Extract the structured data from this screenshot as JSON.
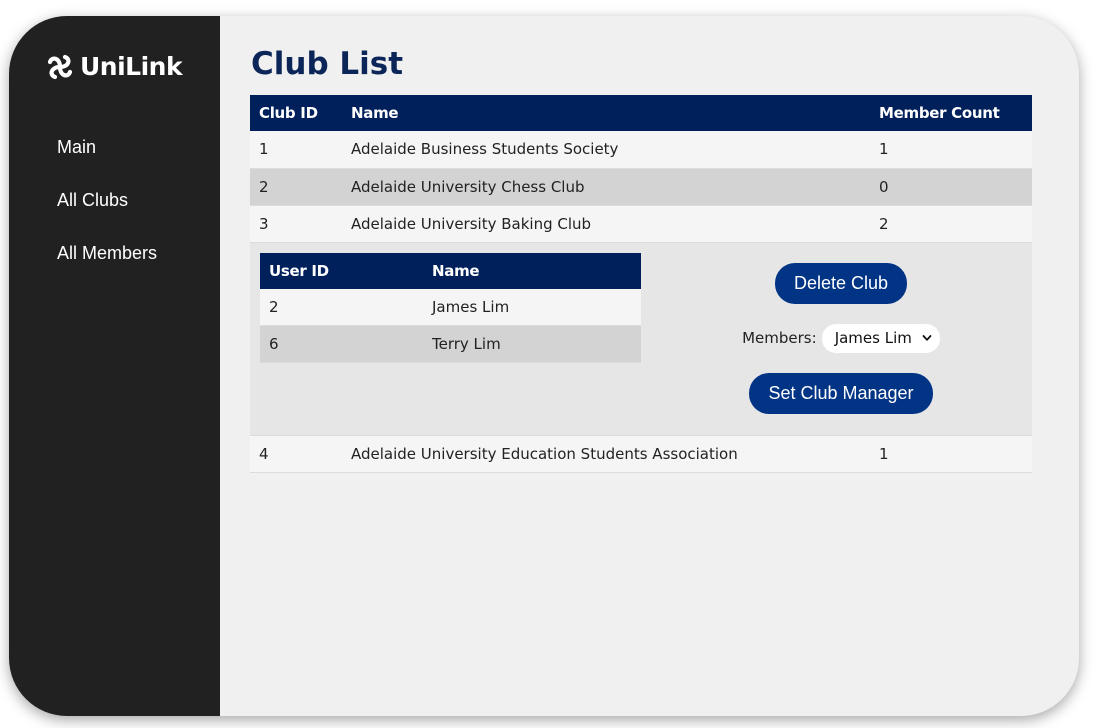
{
  "brand": {
    "name": "UniLink"
  },
  "sidebar": {
    "items": [
      {
        "label": "Main"
      },
      {
        "label": "All Clubs"
      },
      {
        "label": "All Members"
      }
    ]
  },
  "page": {
    "title": "Club List"
  },
  "clubs_table": {
    "headers": {
      "id": "Club ID",
      "name": "Name",
      "count": "Member Count"
    },
    "rows": [
      {
        "id": "1",
        "name": "Adelaide Business Students Society",
        "count": "1"
      },
      {
        "id": "2",
        "name": "Adelaide University Chess Club",
        "count": "0"
      },
      {
        "id": "3",
        "name": "Adelaide University Baking Club",
        "count": "2"
      },
      {
        "id": "4",
        "name": "Adelaide University Education Students Association",
        "count": "1"
      }
    ]
  },
  "club_detail": {
    "headers": {
      "user_id": "User ID",
      "name": "Name"
    },
    "members": [
      {
        "user_id": "2",
        "name": "James Lim"
      },
      {
        "user_id": "6",
        "name": "Terry Lim"
      }
    ],
    "delete_label": "Delete Club",
    "members_label": "Members:",
    "selected_member": "James Lim",
    "set_manager_label": "Set Club Manager"
  },
  "colors": {
    "sidebar_bg": "#212121",
    "header_bg": "#00205b",
    "button_bg": "#023485",
    "title": "#0c2559"
  }
}
